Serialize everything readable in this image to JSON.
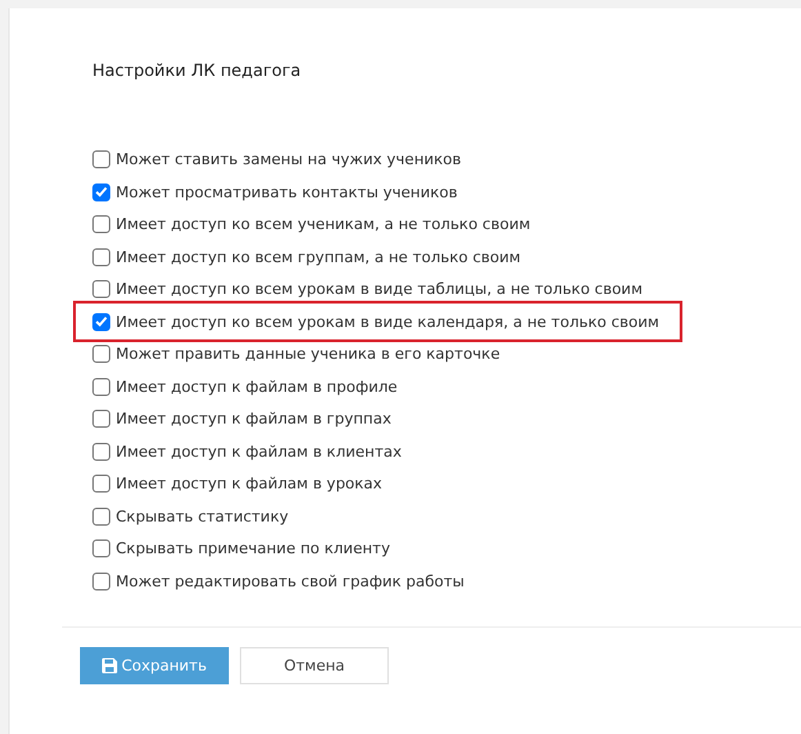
{
  "title": "Настройки ЛК педагога",
  "permissions": [
    {
      "label": "Может ставить замены на чужих учеников",
      "checked": false,
      "highlighted": false
    },
    {
      "label": "Может просматривать контакты учеников",
      "checked": true,
      "highlighted": false
    },
    {
      "label": "Имеет доступ ко всем ученикам, а не только своим",
      "checked": false,
      "highlighted": false
    },
    {
      "label": "Имеет доступ ко всем группам, а не только своим",
      "checked": false,
      "highlighted": false
    },
    {
      "label": "Имеет доступ ко всем урокам в виде таблицы, а не только своим",
      "checked": false,
      "highlighted": false
    },
    {
      "label": "Имеет доступ ко всем урокам в виде календаря, а не только своим",
      "checked": true,
      "highlighted": true
    },
    {
      "label": "Может править данные ученика в его карточке",
      "checked": false,
      "highlighted": false
    },
    {
      "label": "Имеет доступ к файлам в профиле",
      "checked": false,
      "highlighted": false
    },
    {
      "label": "Имеет доступ к файлам в группах",
      "checked": false,
      "highlighted": false
    },
    {
      "label": "Имеет доступ к файлам в клиентах",
      "checked": false,
      "highlighted": false
    },
    {
      "label": "Имеет доступ к файлам в уроках",
      "checked": false,
      "highlighted": false
    },
    {
      "label": "Скрывать статистику",
      "checked": false,
      "highlighted": false
    },
    {
      "label": "Скрывать примечание по клиенту",
      "checked": false,
      "highlighted": false
    },
    {
      "label": "Может редактировать свой график работы",
      "checked": false,
      "highlighted": false
    }
  ],
  "buttons": [
    {
      "kind": "primary",
      "label": "Сохранить"
    },
    {
      "kind": "secondary",
      "label": "Отмена"
    }
  ]
}
